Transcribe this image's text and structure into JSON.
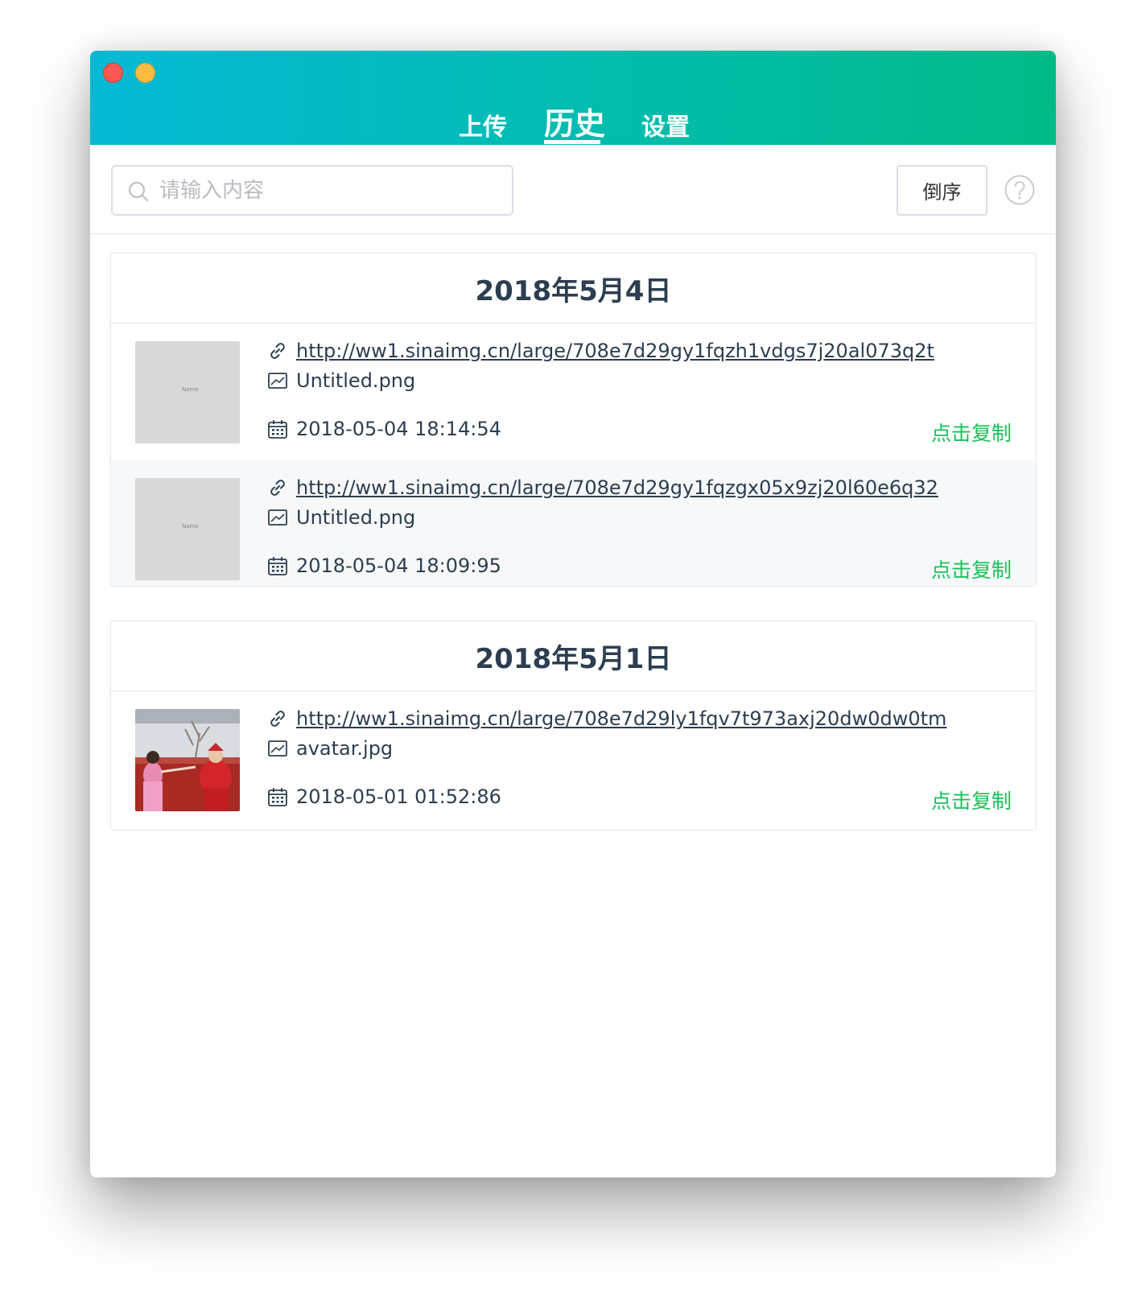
{
  "tabs": {
    "upload": "上传",
    "history": "历史",
    "settings": "设置"
  },
  "search": {
    "placeholder": "请输入内容",
    "value": ""
  },
  "sort_label": "倒序",
  "accent_color": "#19c15a",
  "groups": [
    {
      "date": "2018年5月4日",
      "items": [
        {
          "url": "http://ww1.sinaimg.cn/large/708e7d29gy1fqzh1vdgs7j20al073q2t",
          "file": "Untitled.png",
          "time": "2018-05-04 18:14:54",
          "thumb_text": "Name",
          "copy": "点击复制"
        },
        {
          "url": "http://ww1.sinaimg.cn/large/708e7d29gy1fqzgx05x9zj20l60e6q32",
          "file": "Untitled.png",
          "time": "2018-05-04 18:09:95",
          "thumb_text": "Name",
          "copy": "点击复制"
        }
      ]
    },
    {
      "date": "2018年5月1日",
      "items": [
        {
          "url": "http://ww1.sinaimg.cn/large/708e7d29ly1fqv7t973axj20dw0dw0tm",
          "file": "avatar.jpg",
          "time": "2018-05-01 01:52:86",
          "copy": "点击复制"
        }
      ]
    }
  ]
}
